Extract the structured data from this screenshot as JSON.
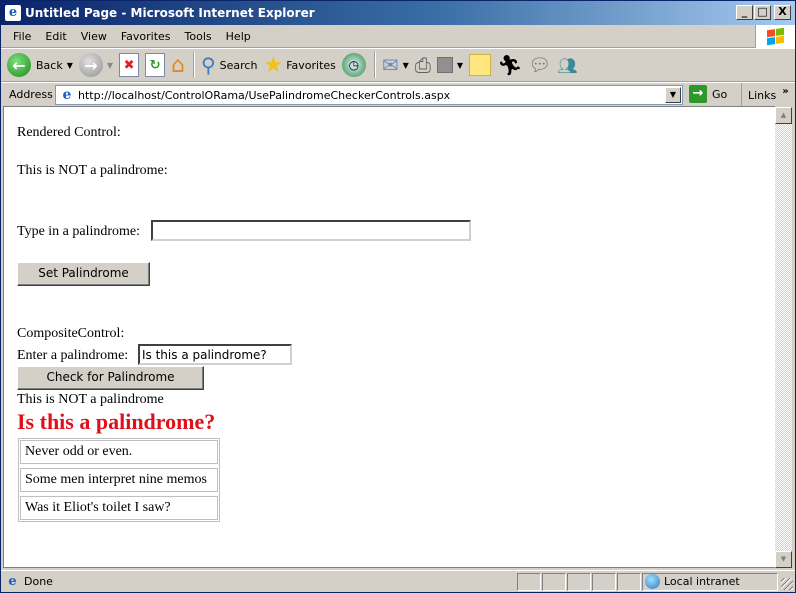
{
  "window": {
    "title": "Untitled Page - Microsoft Internet Explorer",
    "buttons": {
      "minimize": "_",
      "maximize": "□",
      "close": "X"
    }
  },
  "menu": [
    "File",
    "Edit",
    "View",
    "Favorites",
    "Tools",
    "Help"
  ],
  "toolbar": {
    "back_label": "Back",
    "search_label": "Search",
    "favorites_label": "Favorites"
  },
  "address": {
    "label": "Address",
    "url": "http://localhost/ControlORama/UsePalindromeCheckerControls.aspx",
    "go_label": "Go",
    "links_label": "Links"
  },
  "page": {
    "rendered_heading": "Rendered Control:",
    "rendered_result": "This is NOT a palindrome:",
    "type_label": "Type in a palindrome:",
    "type_value": "",
    "set_button": "Set Palindrome",
    "composite_heading": "CompositeControl:",
    "enter_label": "Enter a palindrome:",
    "enter_value": "Is this a palindrome?",
    "check_button": "Check for Palindrome",
    "composite_result": "This is NOT a palindrome",
    "big_text": "Is this a palindrome?",
    "big_text_color": "#e0101a",
    "palindromes": [
      "Never odd or even.",
      "Some men interpret nine memos",
      "Was it Eliot's toilet I saw?"
    ]
  },
  "status": {
    "text": "Done",
    "zone": "Local intranet"
  }
}
